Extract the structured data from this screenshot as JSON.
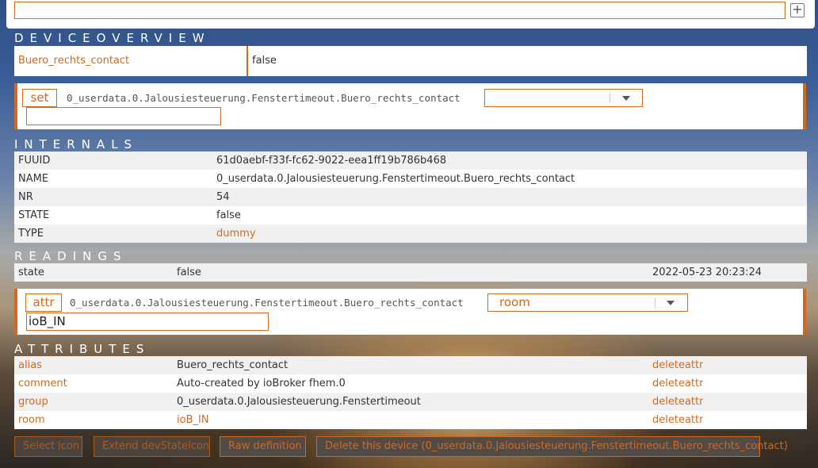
{
  "topbar": {
    "command_value": ""
  },
  "device_overview": {
    "title": "DEVICEOVERVIEW",
    "name": "Buero_rechts_contact",
    "state": "false"
  },
  "set_cmd": {
    "button": "set",
    "device": "0_userdata.0.Jalousiesteuerung.Fenstertimeout.Buero_rechts_contact",
    "select_value": "",
    "input_value": ""
  },
  "internals": {
    "title": "INTERNALS",
    "rows": [
      {
        "key": "FUUID",
        "value": "61d0aebf-f33f-fc62-9022-eea1ff19b786b468"
      },
      {
        "key": "NAME",
        "value": "0_userdata.0.Jalousiesteuerung.Fenstertimeout.Buero_rechts_contact"
      },
      {
        "key": "NR",
        "value": "54"
      },
      {
        "key": "STATE",
        "value": "false"
      },
      {
        "key": "TYPE",
        "value": "dummy"
      }
    ]
  },
  "readings": {
    "title": "READINGS",
    "rows": [
      {
        "key": "state",
        "value": "false",
        "time": "2022-05-23 20:23:24"
      }
    ]
  },
  "attr_cmd": {
    "button": "attr",
    "device": "0_userdata.0.Jalousiesteuerung.Fenstertimeout.Buero_rechts_contact",
    "select_value": "room",
    "input_value": "ioB_IN"
  },
  "attributes": {
    "title": "ATTRIBUTES",
    "rows": [
      {
        "key": "alias",
        "value": "Buero_rechts_contact",
        "action": "deleteattr"
      },
      {
        "key": "comment",
        "value": "Auto-created by ioBroker fhem.0",
        "action": "deleteattr"
      },
      {
        "key": "group",
        "value": "0_userdata.0.Jalousiesteuerung.Fenstertimeout",
        "action": "deleteattr"
      },
      {
        "key": "room",
        "value": "ioB_IN",
        "action": "deleteattr"
      }
    ]
  },
  "buttons": {
    "select_icon": "Select icon",
    "extend_devstateicon": "Extend devStateIcon",
    "raw_definition": "Raw definition",
    "delete_device": "Delete this device (0_userdata.0.Jalousiesteuerung.Fenstertimeout.Buero_rechts_contact)"
  },
  "colors": {
    "accent": "#d2691e"
  }
}
